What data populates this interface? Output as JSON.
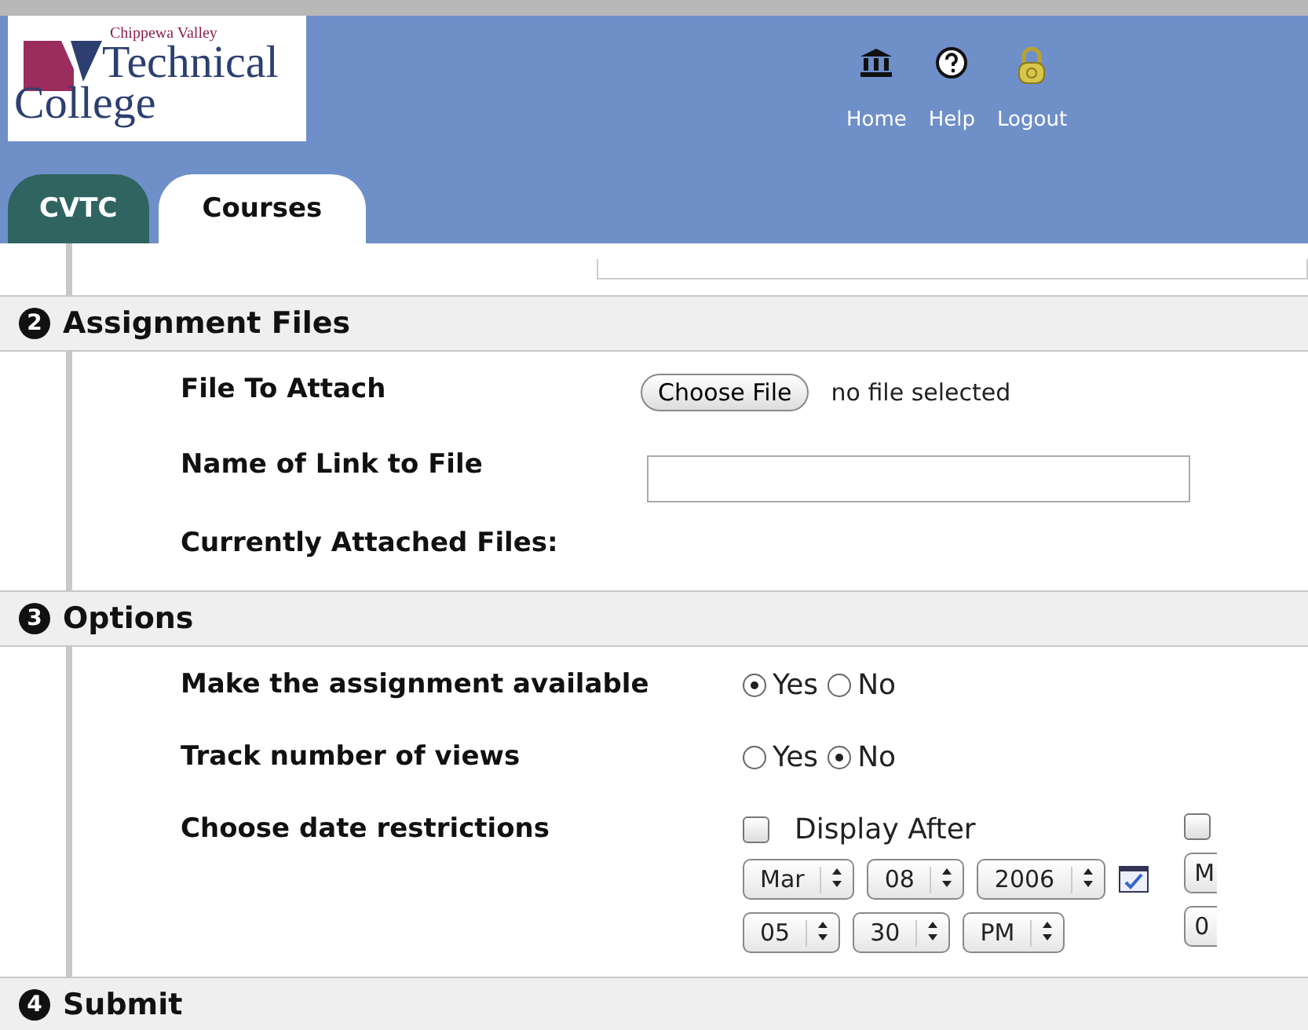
{
  "header": {
    "logo": {
      "small": "Chippewa Valley",
      "line1": "Technical",
      "line2": "College"
    },
    "nav": [
      {
        "kind": "home",
        "label": "Home"
      },
      {
        "kind": "help",
        "label": "Help"
      },
      {
        "kind": "lock",
        "label": "Logout"
      }
    ]
  },
  "tabs": [
    {
      "label": "CVTC",
      "selected": false
    },
    {
      "label": "Courses",
      "selected": true
    }
  ],
  "sections": [
    {
      "number": "2",
      "title": "Assignment Files",
      "rows": [
        {
          "kind": "file",
          "label": "File To Attach",
          "button": "Choose File",
          "status": "no file selected"
        },
        {
          "kind": "text",
          "label": "Name of Link to File"
        },
        {
          "kind": "none",
          "label": "Currently Attached Files:"
        }
      ]
    },
    {
      "number": "3",
      "title": "Options",
      "rows": [
        {
          "kind": "radio",
          "label": "Make the assignment available",
          "options": [
            {
              "label": "Yes",
              "selected": true
            },
            {
              "label": "No",
              "selected": false
            }
          ]
        },
        {
          "kind": "radio",
          "label": "Track number of views",
          "options": [
            {
              "label": "Yes",
              "selected": false
            },
            {
              "label": "No",
              "selected": true
            }
          ]
        },
        {
          "kind": "dates",
          "label": "Choose date restrictions",
          "groups": [
            {
              "checked": false,
              "label": "Display After",
              "date": [
                "Mar",
                "08",
                "2006"
              ],
              "time": [
                "05",
                "30",
                "PM"
              ]
            },
            {
              "checked": false,
              "date": [
                "M"
              ],
              "time": [
                "0"
              ]
            }
          ]
        }
      ]
    },
    {
      "number": "4",
      "title": "Submit"
    }
  ]
}
